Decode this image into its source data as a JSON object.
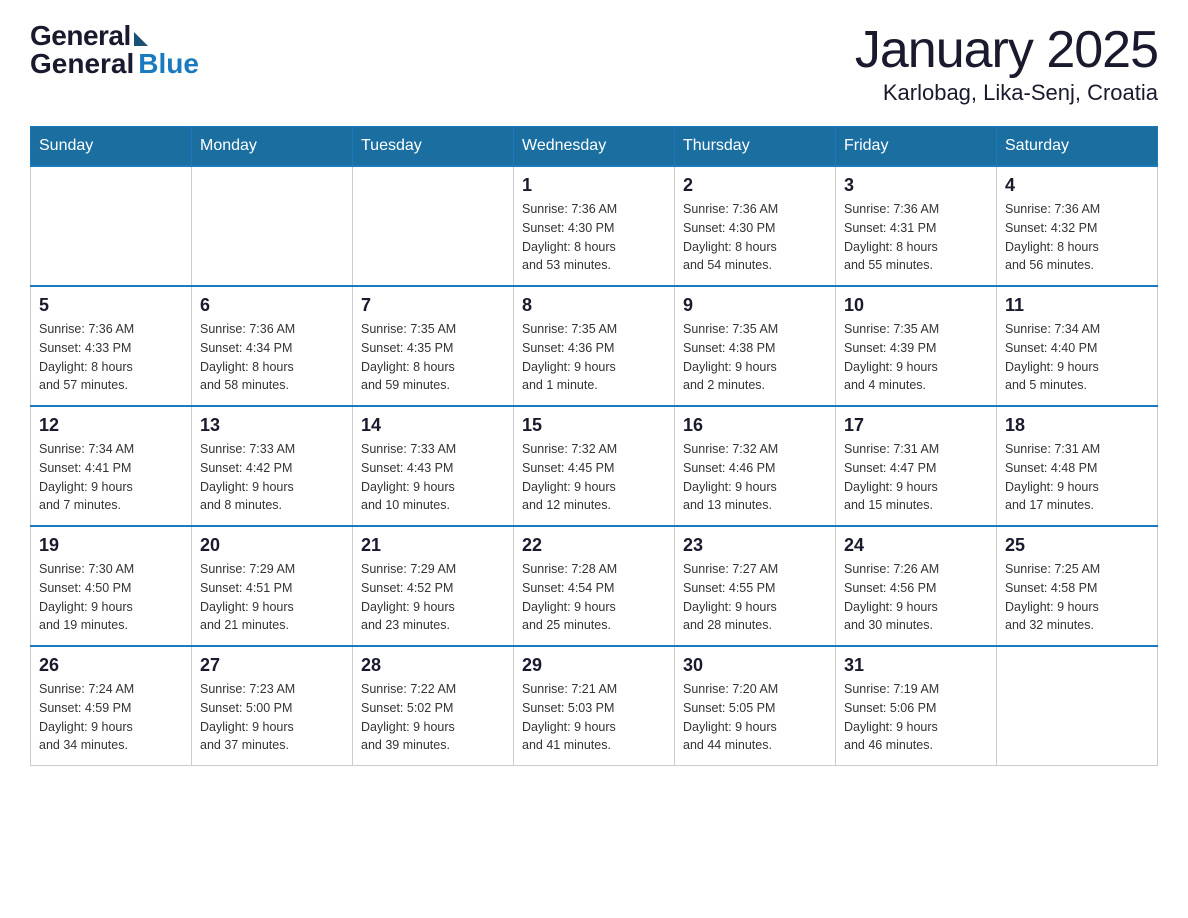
{
  "header": {
    "logo_general": "General",
    "logo_blue": "Blue",
    "month_title": "January 2025",
    "location": "Karlobag, Lika-Senj, Croatia"
  },
  "days_of_week": [
    "Sunday",
    "Monday",
    "Tuesday",
    "Wednesday",
    "Thursday",
    "Friday",
    "Saturday"
  ],
  "weeks": [
    [
      {
        "day": "",
        "info": ""
      },
      {
        "day": "",
        "info": ""
      },
      {
        "day": "",
        "info": ""
      },
      {
        "day": "1",
        "info": "Sunrise: 7:36 AM\nSunset: 4:30 PM\nDaylight: 8 hours\nand 53 minutes."
      },
      {
        "day": "2",
        "info": "Sunrise: 7:36 AM\nSunset: 4:30 PM\nDaylight: 8 hours\nand 54 minutes."
      },
      {
        "day": "3",
        "info": "Sunrise: 7:36 AM\nSunset: 4:31 PM\nDaylight: 8 hours\nand 55 minutes."
      },
      {
        "day": "4",
        "info": "Sunrise: 7:36 AM\nSunset: 4:32 PM\nDaylight: 8 hours\nand 56 minutes."
      }
    ],
    [
      {
        "day": "5",
        "info": "Sunrise: 7:36 AM\nSunset: 4:33 PM\nDaylight: 8 hours\nand 57 minutes."
      },
      {
        "day": "6",
        "info": "Sunrise: 7:36 AM\nSunset: 4:34 PM\nDaylight: 8 hours\nand 58 minutes."
      },
      {
        "day": "7",
        "info": "Sunrise: 7:35 AM\nSunset: 4:35 PM\nDaylight: 8 hours\nand 59 minutes."
      },
      {
        "day": "8",
        "info": "Sunrise: 7:35 AM\nSunset: 4:36 PM\nDaylight: 9 hours\nand 1 minute."
      },
      {
        "day": "9",
        "info": "Sunrise: 7:35 AM\nSunset: 4:38 PM\nDaylight: 9 hours\nand 2 minutes."
      },
      {
        "day": "10",
        "info": "Sunrise: 7:35 AM\nSunset: 4:39 PM\nDaylight: 9 hours\nand 4 minutes."
      },
      {
        "day": "11",
        "info": "Sunrise: 7:34 AM\nSunset: 4:40 PM\nDaylight: 9 hours\nand 5 minutes."
      }
    ],
    [
      {
        "day": "12",
        "info": "Sunrise: 7:34 AM\nSunset: 4:41 PM\nDaylight: 9 hours\nand 7 minutes."
      },
      {
        "day": "13",
        "info": "Sunrise: 7:33 AM\nSunset: 4:42 PM\nDaylight: 9 hours\nand 8 minutes."
      },
      {
        "day": "14",
        "info": "Sunrise: 7:33 AM\nSunset: 4:43 PM\nDaylight: 9 hours\nand 10 minutes."
      },
      {
        "day": "15",
        "info": "Sunrise: 7:32 AM\nSunset: 4:45 PM\nDaylight: 9 hours\nand 12 minutes."
      },
      {
        "day": "16",
        "info": "Sunrise: 7:32 AM\nSunset: 4:46 PM\nDaylight: 9 hours\nand 13 minutes."
      },
      {
        "day": "17",
        "info": "Sunrise: 7:31 AM\nSunset: 4:47 PM\nDaylight: 9 hours\nand 15 minutes."
      },
      {
        "day": "18",
        "info": "Sunrise: 7:31 AM\nSunset: 4:48 PM\nDaylight: 9 hours\nand 17 minutes."
      }
    ],
    [
      {
        "day": "19",
        "info": "Sunrise: 7:30 AM\nSunset: 4:50 PM\nDaylight: 9 hours\nand 19 minutes."
      },
      {
        "day": "20",
        "info": "Sunrise: 7:29 AM\nSunset: 4:51 PM\nDaylight: 9 hours\nand 21 minutes."
      },
      {
        "day": "21",
        "info": "Sunrise: 7:29 AM\nSunset: 4:52 PM\nDaylight: 9 hours\nand 23 minutes."
      },
      {
        "day": "22",
        "info": "Sunrise: 7:28 AM\nSunset: 4:54 PM\nDaylight: 9 hours\nand 25 minutes."
      },
      {
        "day": "23",
        "info": "Sunrise: 7:27 AM\nSunset: 4:55 PM\nDaylight: 9 hours\nand 28 minutes."
      },
      {
        "day": "24",
        "info": "Sunrise: 7:26 AM\nSunset: 4:56 PM\nDaylight: 9 hours\nand 30 minutes."
      },
      {
        "day": "25",
        "info": "Sunrise: 7:25 AM\nSunset: 4:58 PM\nDaylight: 9 hours\nand 32 minutes."
      }
    ],
    [
      {
        "day": "26",
        "info": "Sunrise: 7:24 AM\nSunset: 4:59 PM\nDaylight: 9 hours\nand 34 minutes."
      },
      {
        "day": "27",
        "info": "Sunrise: 7:23 AM\nSunset: 5:00 PM\nDaylight: 9 hours\nand 37 minutes."
      },
      {
        "day": "28",
        "info": "Sunrise: 7:22 AM\nSunset: 5:02 PM\nDaylight: 9 hours\nand 39 minutes."
      },
      {
        "day": "29",
        "info": "Sunrise: 7:21 AM\nSunset: 5:03 PM\nDaylight: 9 hours\nand 41 minutes."
      },
      {
        "day": "30",
        "info": "Sunrise: 7:20 AM\nSunset: 5:05 PM\nDaylight: 9 hours\nand 44 minutes."
      },
      {
        "day": "31",
        "info": "Sunrise: 7:19 AM\nSunset: 5:06 PM\nDaylight: 9 hours\nand 46 minutes."
      },
      {
        "day": "",
        "info": ""
      }
    ]
  ]
}
